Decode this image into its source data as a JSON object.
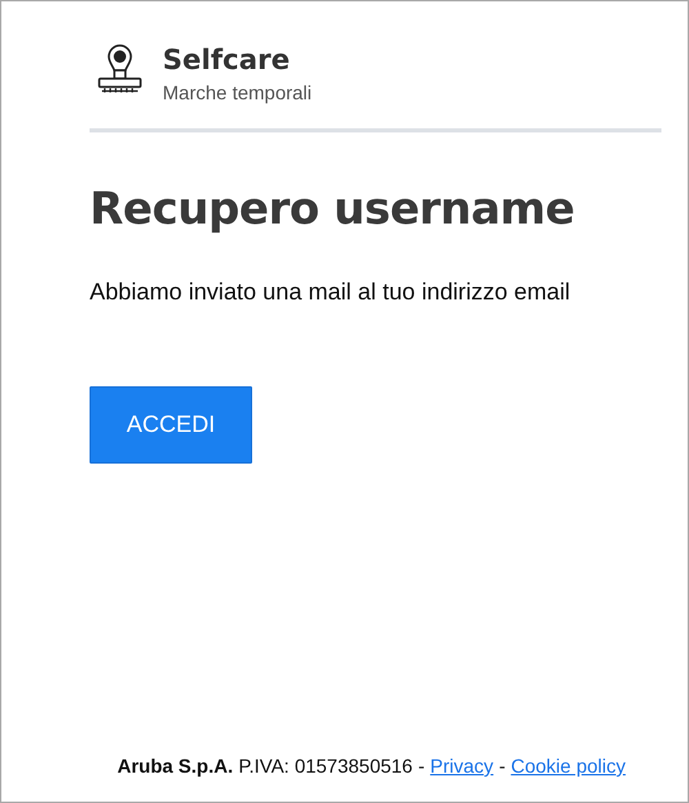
{
  "header": {
    "title": "Selfcare",
    "subtitle": "Marche temporali"
  },
  "heading": "Recupero username",
  "message": "Abbiamo inviato una mail al tuo indirizzo email",
  "button": "ACCEDI",
  "footer": [
    {
      "kind": "company",
      "text": "Aruba S.p.A."
    },
    {
      "kind": "text",
      "text": "P.IVA: 01573850516"
    },
    {
      "kind": "text",
      "text": "-"
    },
    {
      "kind": "link",
      "text": "Privacy"
    },
    {
      "kind": "text",
      "text": "-"
    },
    {
      "kind": "link",
      "text": "Cookie policy"
    }
  ]
}
